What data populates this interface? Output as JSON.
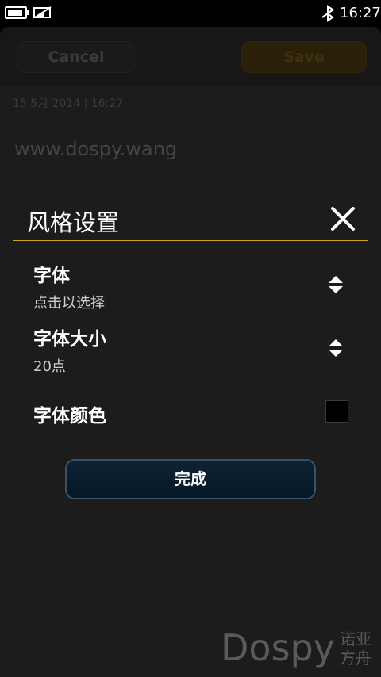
{
  "status_bar": {
    "time": "16:27",
    "battery_level": 0.8,
    "icons": [
      "battery-icon",
      "no-signal-icon",
      "bluetooth-icon"
    ]
  },
  "background": {
    "cancel_label": "Cancel",
    "save_label": "Save",
    "date": "15 5月 2014 | 16:27",
    "note_text": "www.dospy.wang"
  },
  "dialog": {
    "title": "风格设置",
    "close_icon": "close-icon",
    "accent_color": "#c9a227",
    "items": [
      {
        "label": "字体",
        "value": "点击以选择",
        "control": "spinner-icon"
      },
      {
        "label": "字体大小",
        "value": "20点",
        "control": "spinner-icon"
      },
      {
        "label": "字体颜色",
        "value": "#000000",
        "control": "color-swatch"
      }
    ],
    "done_label": "完成"
  },
  "watermark": {
    "latin": "Dospy",
    "cn_line1": "诺亚",
    "cn_line2": "方舟"
  }
}
